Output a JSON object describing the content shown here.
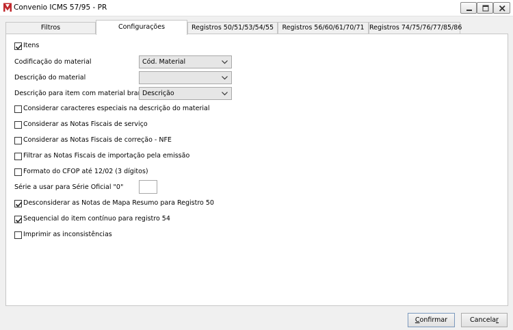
{
  "window": {
    "title": "Convenio ICMS 57/95 - PR",
    "controls": {
      "minimize_icon": "minimize-icon",
      "maximize_icon": "maximize-icon",
      "close_icon": "close-icon"
    }
  },
  "tabs": [
    {
      "label": "Filtros",
      "active": false
    },
    {
      "label": "Configurações",
      "active": true
    },
    {
      "label": "Registros 50/51/53/54/55",
      "active": false
    },
    {
      "label": "Registros 56/60/61/70/71",
      "active": false
    },
    {
      "label": "Registros 74/75/76/77/85/86",
      "active": false
    }
  ],
  "form": {
    "itens": {
      "label": "Itens",
      "checked": true
    },
    "codificacao": {
      "label": "Codificação do material",
      "value": "Cód. Material"
    },
    "descricao": {
      "label": "Descrição do material",
      "value": ""
    },
    "descricao_branco": {
      "label": "Descrição para item com material branco",
      "value": "Descrição"
    },
    "checkboxes": [
      {
        "label": "Considerar caracteres especiais na descrição do material",
        "checked": false
      },
      {
        "label": "Considerar as Notas Fiscais de serviço",
        "checked": false
      },
      {
        "label": "Considerar as Notas Fiscais de correção - NFE",
        "checked": false
      },
      {
        "label": "Filtrar as Notas Fiscais de importação pela emissão",
        "checked": false
      },
      {
        "label": "Formato do CFOP até 12/02 (3 dígitos)",
        "checked": false
      }
    ],
    "serie": {
      "label": "Série a usar para Série Oficial \"0\"",
      "value": ""
    },
    "checkboxes2": [
      {
        "label": "Desconsiderar as Notas de Mapa Resumo para Registro 50",
        "checked": true
      },
      {
        "label": "Sequencial do item contínuo para registro 54",
        "checked": true
      },
      {
        "label": "Imprimir as inconsistências",
        "checked": false
      }
    ]
  },
  "buttons": {
    "ok": {
      "mnemonic": "C",
      "rest": "onfirmar"
    },
    "cancel": {
      "prefix": "Cancela",
      "mnemonic": "r"
    }
  },
  "colors": {
    "app_icon": "#c0282d",
    "panel_bg": "#ffffff",
    "window_bg": "#f0f0f0"
  }
}
